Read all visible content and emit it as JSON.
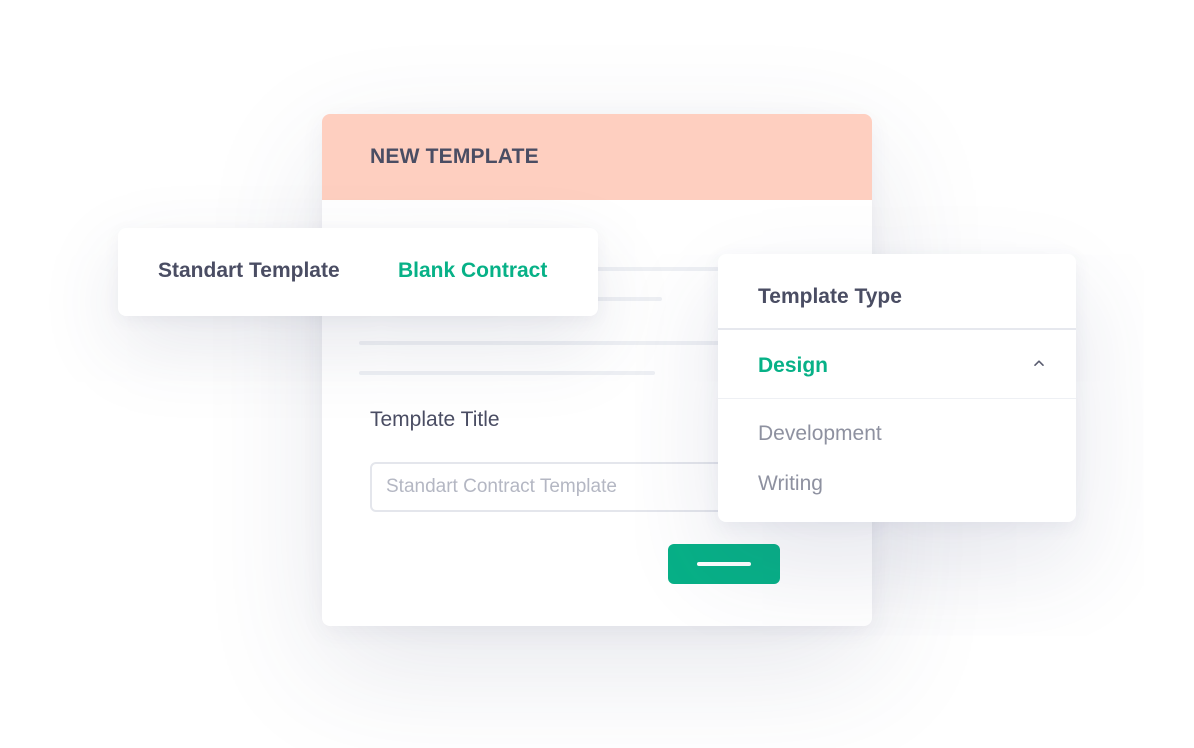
{
  "main_card": {
    "title": "NEW TEMPLATE",
    "header_color": "#fecfc0",
    "field_label": "Template Title",
    "input_placeholder": "Standart Contract Template",
    "input_value": "",
    "submit_button_color": "#07b187"
  },
  "tabs": {
    "items": [
      {
        "label": "Standart Template",
        "active": false
      },
      {
        "label": "Blank Contract",
        "active": true
      }
    ],
    "active_color": "#07b187"
  },
  "dropdown": {
    "title": "Template Type",
    "selected": "Design",
    "expanded": true,
    "indicator_icon": "chevron-up-icon",
    "options": [
      "Development",
      "Writing"
    ]
  }
}
